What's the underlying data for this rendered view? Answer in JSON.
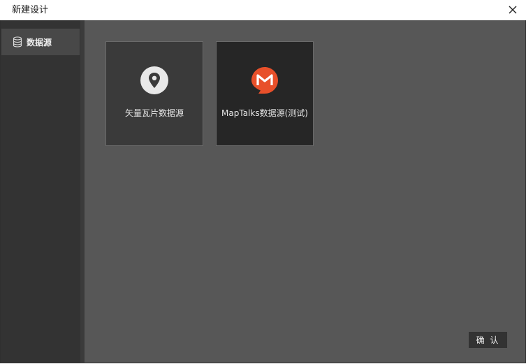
{
  "window": {
    "title": "新建设计",
    "close_icon": "close-icon"
  },
  "sidebar": {
    "items": [
      {
        "label": "数据源",
        "icon": "database-icon",
        "selected": true
      }
    ]
  },
  "main": {
    "cards": [
      {
        "label": "矢量瓦片数据源",
        "icon": "map-pin-icon",
        "icon_bg": "#e8e8e8",
        "icon_fg": "#3a3a3a"
      },
      {
        "label": "MapTalks数据源(测试)",
        "icon": "maptalks-logo-icon",
        "icon_bg": "#e8502a",
        "icon_fg": "#ffffff"
      }
    ],
    "confirm_label": "确 认"
  },
  "colors": {
    "sidebar_bg": "#333333",
    "sidebar_selected_bg": "#484848",
    "content_bg": "#575757",
    "accent_orange": "#e8502a"
  }
}
